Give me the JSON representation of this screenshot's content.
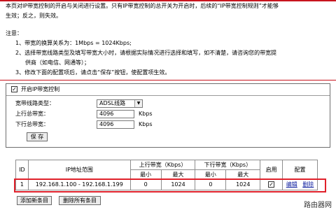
{
  "intro": {
    "line1": "本页对IP带宽控制的开启与关闭进行设置。只有IP带宽控制的总开关为开启时，后续的“IP带宽控制规则”才能够",
    "line2": "生效；反之，则失效。"
  },
  "notes": {
    "title": "注意：",
    "item1": "1、带宽的换算关系为：1Mbps = 1024Kbps;",
    "item2a": "2、选择带宽线路类型及填写带宽大小时，请根据实际情况进行选择和填写，如不清楚，请咨询您的带宽提",
    "item2b": "供商（如电信、网通等）；",
    "item3": "3、修改下面的配置项后，请点击“保存”按钮，使配置项生效。"
  },
  "control": {
    "enable_checked": true,
    "enable_label": "开启IP带宽控制",
    "line_type_label": "宽带线路类型：",
    "line_type_value": "ADSL线路",
    "up_label": "上行总带宽：",
    "up_value": "4096",
    "down_label": "下行总带宽：",
    "down_value": "4096",
    "unit": "Kbps",
    "save_label": "保 存"
  },
  "table": {
    "headers": {
      "id": "ID",
      "ip_range": "IP地址范围",
      "up": "上行带宽（Kbps）",
      "down": "下行带宽（Kbps）",
      "min": "最小",
      "max": "最大",
      "enabled": "启用",
      "config": "配置"
    },
    "rows": [
      {
        "id": "1",
        "ip_range": "192.168.1.100 - 192.168.1.199",
        "up_min": "0",
        "up_max": "1024",
        "down_min": "0",
        "down_max": "1024",
        "enabled": true,
        "edit_label": "编辑",
        "delete_label": "删除"
      }
    ]
  },
  "actions": {
    "add_label": "添加新条目",
    "delete_all_label": "删除所有条目"
  },
  "watermark": "路由器网"
}
